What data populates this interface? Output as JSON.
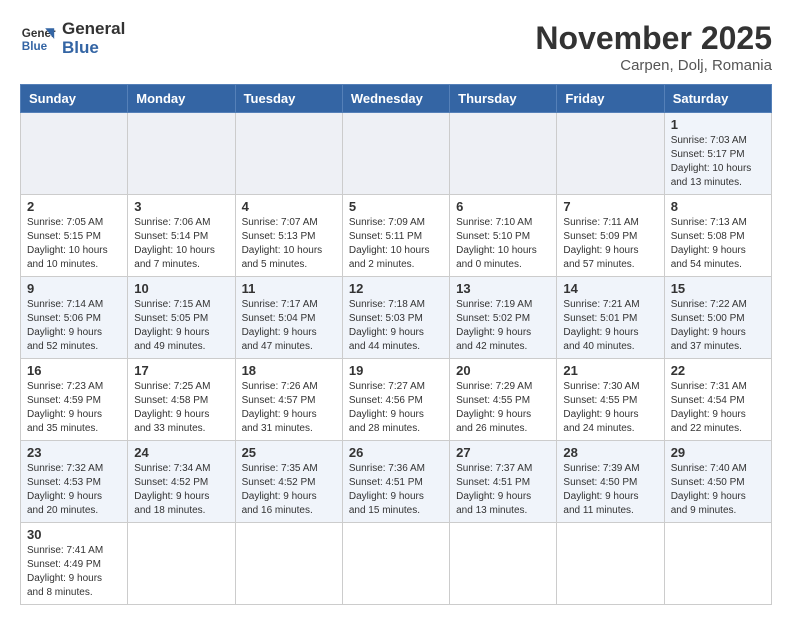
{
  "logo": {
    "line1": "General",
    "line2": "Blue"
  },
  "title": "November 2025",
  "location": "Carpen, Dolj, Romania",
  "weekdays": [
    "Sunday",
    "Monday",
    "Tuesday",
    "Wednesday",
    "Thursday",
    "Friday",
    "Saturday"
  ],
  "weeks": [
    [
      {
        "day": "",
        "info": ""
      },
      {
        "day": "",
        "info": ""
      },
      {
        "day": "",
        "info": ""
      },
      {
        "day": "",
        "info": ""
      },
      {
        "day": "",
        "info": ""
      },
      {
        "day": "",
        "info": ""
      },
      {
        "day": "1",
        "info": "Sunrise: 7:03 AM\nSunset: 5:17 PM\nDaylight: 10 hours\nand 13 minutes."
      }
    ],
    [
      {
        "day": "2",
        "info": "Sunrise: 7:05 AM\nSunset: 5:15 PM\nDaylight: 10 hours\nand 10 minutes."
      },
      {
        "day": "3",
        "info": "Sunrise: 7:06 AM\nSunset: 5:14 PM\nDaylight: 10 hours\nand 7 minutes."
      },
      {
        "day": "4",
        "info": "Sunrise: 7:07 AM\nSunset: 5:13 PM\nDaylight: 10 hours\nand 5 minutes."
      },
      {
        "day": "5",
        "info": "Sunrise: 7:09 AM\nSunset: 5:11 PM\nDaylight: 10 hours\nand 2 minutes."
      },
      {
        "day": "6",
        "info": "Sunrise: 7:10 AM\nSunset: 5:10 PM\nDaylight: 10 hours\nand 0 minutes."
      },
      {
        "day": "7",
        "info": "Sunrise: 7:11 AM\nSunset: 5:09 PM\nDaylight: 9 hours\nand 57 minutes."
      },
      {
        "day": "8",
        "info": "Sunrise: 7:13 AM\nSunset: 5:08 PM\nDaylight: 9 hours\nand 54 minutes."
      }
    ],
    [
      {
        "day": "9",
        "info": "Sunrise: 7:14 AM\nSunset: 5:06 PM\nDaylight: 9 hours\nand 52 minutes."
      },
      {
        "day": "10",
        "info": "Sunrise: 7:15 AM\nSunset: 5:05 PM\nDaylight: 9 hours\nand 49 minutes."
      },
      {
        "day": "11",
        "info": "Sunrise: 7:17 AM\nSunset: 5:04 PM\nDaylight: 9 hours\nand 47 minutes."
      },
      {
        "day": "12",
        "info": "Sunrise: 7:18 AM\nSunset: 5:03 PM\nDaylight: 9 hours\nand 44 minutes."
      },
      {
        "day": "13",
        "info": "Sunrise: 7:19 AM\nSunset: 5:02 PM\nDaylight: 9 hours\nand 42 minutes."
      },
      {
        "day": "14",
        "info": "Sunrise: 7:21 AM\nSunset: 5:01 PM\nDaylight: 9 hours\nand 40 minutes."
      },
      {
        "day": "15",
        "info": "Sunrise: 7:22 AM\nSunset: 5:00 PM\nDaylight: 9 hours\nand 37 minutes."
      }
    ],
    [
      {
        "day": "16",
        "info": "Sunrise: 7:23 AM\nSunset: 4:59 PM\nDaylight: 9 hours\nand 35 minutes."
      },
      {
        "day": "17",
        "info": "Sunrise: 7:25 AM\nSunset: 4:58 PM\nDaylight: 9 hours\nand 33 minutes."
      },
      {
        "day": "18",
        "info": "Sunrise: 7:26 AM\nSunset: 4:57 PM\nDaylight: 9 hours\nand 31 minutes."
      },
      {
        "day": "19",
        "info": "Sunrise: 7:27 AM\nSunset: 4:56 PM\nDaylight: 9 hours\nand 28 minutes."
      },
      {
        "day": "20",
        "info": "Sunrise: 7:29 AM\nSunset: 4:55 PM\nDaylight: 9 hours\nand 26 minutes."
      },
      {
        "day": "21",
        "info": "Sunrise: 7:30 AM\nSunset: 4:55 PM\nDaylight: 9 hours\nand 24 minutes."
      },
      {
        "day": "22",
        "info": "Sunrise: 7:31 AM\nSunset: 4:54 PM\nDaylight: 9 hours\nand 22 minutes."
      }
    ],
    [
      {
        "day": "23",
        "info": "Sunrise: 7:32 AM\nSunset: 4:53 PM\nDaylight: 9 hours\nand 20 minutes."
      },
      {
        "day": "24",
        "info": "Sunrise: 7:34 AM\nSunset: 4:52 PM\nDaylight: 9 hours\nand 18 minutes."
      },
      {
        "day": "25",
        "info": "Sunrise: 7:35 AM\nSunset: 4:52 PM\nDaylight: 9 hours\nand 16 minutes."
      },
      {
        "day": "26",
        "info": "Sunrise: 7:36 AM\nSunset: 4:51 PM\nDaylight: 9 hours\nand 15 minutes."
      },
      {
        "day": "27",
        "info": "Sunrise: 7:37 AM\nSunset: 4:51 PM\nDaylight: 9 hours\nand 13 minutes."
      },
      {
        "day": "28",
        "info": "Sunrise: 7:39 AM\nSunset: 4:50 PM\nDaylight: 9 hours\nand 11 minutes."
      },
      {
        "day": "29",
        "info": "Sunrise: 7:40 AM\nSunset: 4:50 PM\nDaylight: 9 hours\nand 9 minutes."
      }
    ],
    [
      {
        "day": "30",
        "info": "Sunrise: 7:41 AM\nSunset: 4:49 PM\nDaylight: 9 hours\nand 8 minutes."
      },
      {
        "day": "",
        "info": ""
      },
      {
        "day": "",
        "info": ""
      },
      {
        "day": "",
        "info": ""
      },
      {
        "day": "",
        "info": ""
      },
      {
        "day": "",
        "info": ""
      },
      {
        "day": "",
        "info": ""
      }
    ]
  ]
}
